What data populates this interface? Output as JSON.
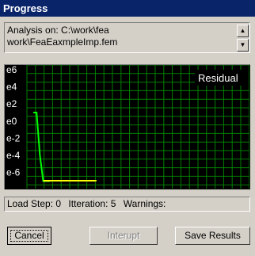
{
  "window": {
    "title": "Progress"
  },
  "analysis": {
    "line1": "Analysis on: C:\\work\\fea",
    "line2": "work\\FeaEaxmpleImp.fem"
  },
  "scrollbar": {
    "up_icon": "triangle-up",
    "down_icon": "triangle-down"
  },
  "chart_data": {
    "type": "line",
    "legend": "Residual",
    "y_axis_labels": [
      "e6",
      "e4",
      "e2",
      "e0",
      "e-2",
      "e-4",
      "e-6"
    ],
    "y_log10_range": [
      -7,
      6.5
    ],
    "x_range": [
      0,
      19
    ],
    "grid": true,
    "series": [
      {
        "name": "Residual",
        "color": "#00ff00",
        "x": [
          0,
          1,
          2,
          3,
          4,
          5
        ],
        "y": [
          1.0,
          1.0,
          -4.0,
          -7.0,
          -7.0,
          -7.0
        ]
      },
      {
        "color": "#ffff00",
        "x": [
          3,
          19
        ],
        "y": [
          -6.95,
          -6.95
        ]
      }
    ]
  },
  "status": {
    "load_step": "Load Step: 0",
    "iteration": "Itteration: 5",
    "warnings": "Warnings:"
  },
  "buttons": {
    "cancel": "Cancel",
    "interupt": "Interupt",
    "save": "Save Results"
  },
  "colors": {
    "title_bar": "#0a246a",
    "chart_bg": "#000000",
    "grid": "#008000",
    "residual_line": "#00ff00",
    "baseline": "#ffff00"
  }
}
